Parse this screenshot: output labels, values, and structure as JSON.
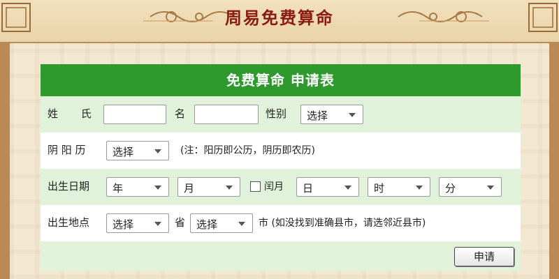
{
  "header": {
    "title": "周易免费算命"
  },
  "form": {
    "title": "免费算命  申请表",
    "name_row": {
      "surname_label": "姓 氏",
      "given_label": "名",
      "gender_label": "性别",
      "gender_select": "选择"
    },
    "calendar_row": {
      "label": "阴 阳 历",
      "select": "选择",
      "note": "(注：阳历即公历，阴历即农历)"
    },
    "birth_row": {
      "label": "出生日期",
      "year": "年",
      "month": "月",
      "leap_label": "闰月",
      "day": "日",
      "hour": "时",
      "minute": "分"
    },
    "place_row": {
      "label": "出生地点",
      "province_select": "选择",
      "province_label": "省",
      "city_select": "选择",
      "city_note": "市 (如没找到准确县市，请选邻近县市)"
    },
    "submit": "申请"
  },
  "colors": {
    "title_bar": "#2e9a2e",
    "row_alt": "#e0f3da",
    "header_text": "#8b1a10",
    "frame": "#b98a54"
  }
}
